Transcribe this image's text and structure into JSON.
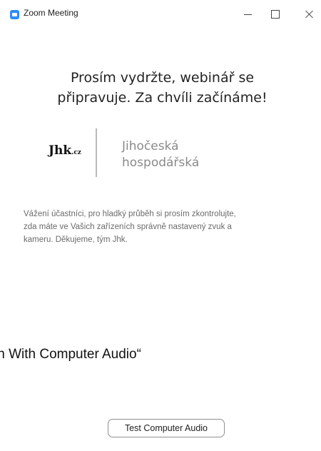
{
  "window": {
    "title": "Zoom Meeting",
    "icon": "zoom-camera-icon",
    "controls": {
      "minimize_icon": "minimize-icon",
      "maximize_icon": "maximize-icon",
      "close_icon": "close-icon"
    }
  },
  "waiting": {
    "headline_line1": "Prosím vydržte, webinář se",
    "headline_line2": "připravuje. Za chvíli začínáme!",
    "logo_text": "Jhk",
    "logo_tld": ".cz",
    "org_line1": "Jihočeská",
    "org_line2": "hospodářská",
    "message_line1": "Vážení účastníci, pro hladký průběh si prosím zkontrolujte,",
    "message_line2": "zda máte ve Vašich zařízeních správně nastavený zvuk a",
    "message_line3": "kameru. Děkujeme, tým Jhk."
  },
  "overlay": {
    "join_text": "in With Computer Audio“"
  },
  "audio": {
    "test_button_label": "Test Computer Audio"
  },
  "colors": {
    "zoom_blue": "#2d8cff",
    "headline": "#232323",
    "org_name": "#8a8a8a",
    "message": "#6b6b6b"
  }
}
